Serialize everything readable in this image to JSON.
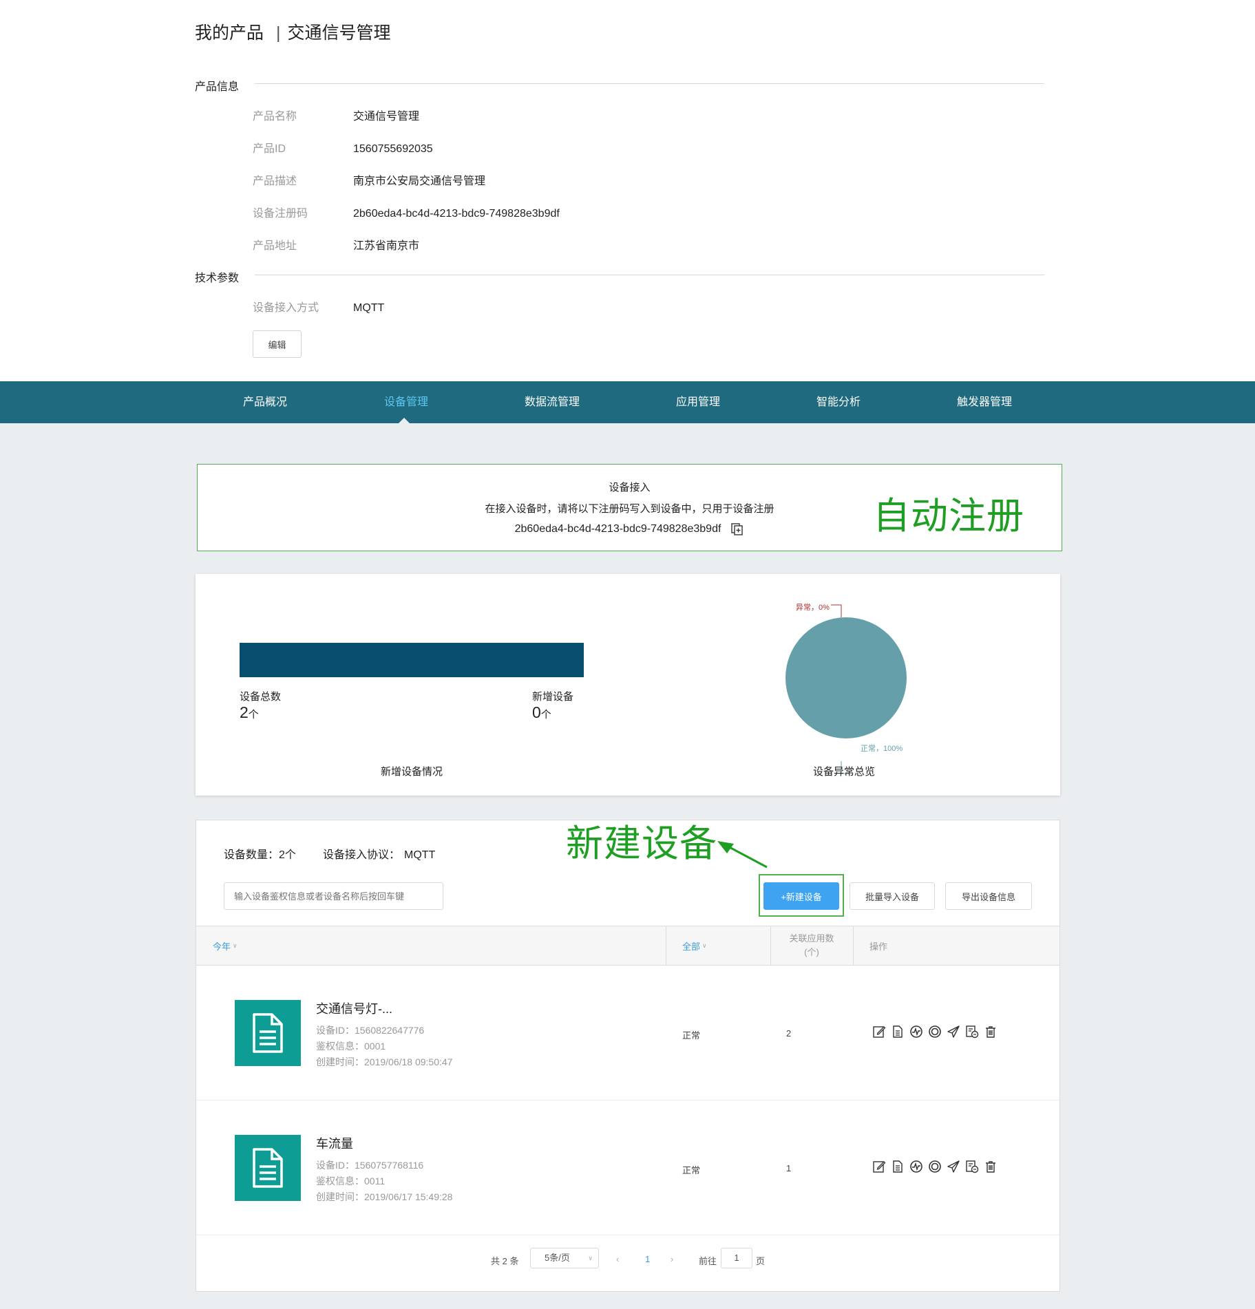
{
  "header": {
    "title_main": "我的产品",
    "title_sep": "|",
    "title_sub": "交通信号管理"
  },
  "product_info": {
    "section_label": "产品信息",
    "rows": [
      {
        "label": "产品名称",
        "value": "交通信号管理"
      },
      {
        "label": "产品ID",
        "value": "1560755692035"
      },
      {
        "label": "产品描述",
        "value": "南京市公安局交通信号管理"
      },
      {
        "label": "设备注册码",
        "value": "2b60eda4-bc4d-4213-bdc9-749828e3b9df"
      },
      {
        "label": "产品地址",
        "value": "江苏省南京市"
      }
    ]
  },
  "tech_params": {
    "section_label": "技术参数",
    "rows": [
      {
        "label": "设备接入方式",
        "value": "MQTT"
      }
    ],
    "edit_label": "编辑"
  },
  "nav": {
    "tabs": [
      {
        "label": "产品概况"
      },
      {
        "label": "设备管理"
      },
      {
        "label": "数据流管理"
      },
      {
        "label": "应用管理"
      },
      {
        "label": "智能分析"
      },
      {
        "label": "触发器管理"
      }
    ],
    "active_index": 1,
    "active_color": "#5cc8f0",
    "bg_color": "#1f6a7e"
  },
  "access_panel": {
    "title": "设备接入",
    "hint": "在接入设备时，请将以下注册码写入到设备中，只用于设备注册",
    "code": "2b60eda4-bc4d-4213-bdc9-749828e3b9df",
    "copy_icon": "copy-icon"
  },
  "annotations": {
    "auto_register": "自动注册",
    "new_device": "新建设备",
    "color": "#1e9e22"
  },
  "stats": {
    "total_label": "设备总数",
    "total_value": "2",
    "total_unit": "个",
    "new_label": "新增设备",
    "new_value": "0",
    "new_unit": "个",
    "bar_caption": "新增设备情况",
    "pie_caption": "设备异常总览",
    "pie_abnormal_label": "异常，0%",
    "pie_normal_label": "正常，100%",
    "pie_normal_pct": 100,
    "pie_abnormal_pct": 0,
    "bar_color": "#064d6e",
    "pie_color": "#65a0aa"
  },
  "device_list": {
    "count_label": "设备数量：",
    "count_value": "2个",
    "protocol_label": "设备接入协议：",
    "protocol_value": "MQTT",
    "search_placeholder": "输入设备鉴权信息或者设备名称后按回车键",
    "buttons": {
      "new": "+新建设备",
      "import": "批量导入设备",
      "export": "导出设备信息"
    },
    "columns": {
      "year": "今年",
      "status": "全部",
      "apps_line1": "关联应用数",
      "apps_line2": "(个)",
      "ops": "操作"
    },
    "rows": [
      {
        "name": "交通信号灯-...",
        "id_label": "设备ID：",
        "id": "1560822647776",
        "auth_label": "鉴权信息：",
        "auth": "0001",
        "created_label": "创建时间：",
        "created": "2019/06/18 09:50:47",
        "status": "正常",
        "apps": "2"
      },
      {
        "name": "车流量",
        "id_label": "设备ID：",
        "id": "1560757768116",
        "auth_label": "鉴权信息：",
        "auth": "0011",
        "created_label": "创建时间：",
        "created": "2019/06/17 15:49:28",
        "status": "正常",
        "apps": "1"
      }
    ],
    "ops_icons": [
      "edit-icon",
      "document-icon",
      "dashboard-icon",
      "circle-icon",
      "send-icon",
      "bill-icon",
      "trash-icon"
    ]
  },
  "pagination": {
    "total": "共 2 条",
    "page_size": "5条/页",
    "current": "1",
    "goto_label": "前往",
    "goto_value": "1",
    "page_suffix": "页"
  }
}
